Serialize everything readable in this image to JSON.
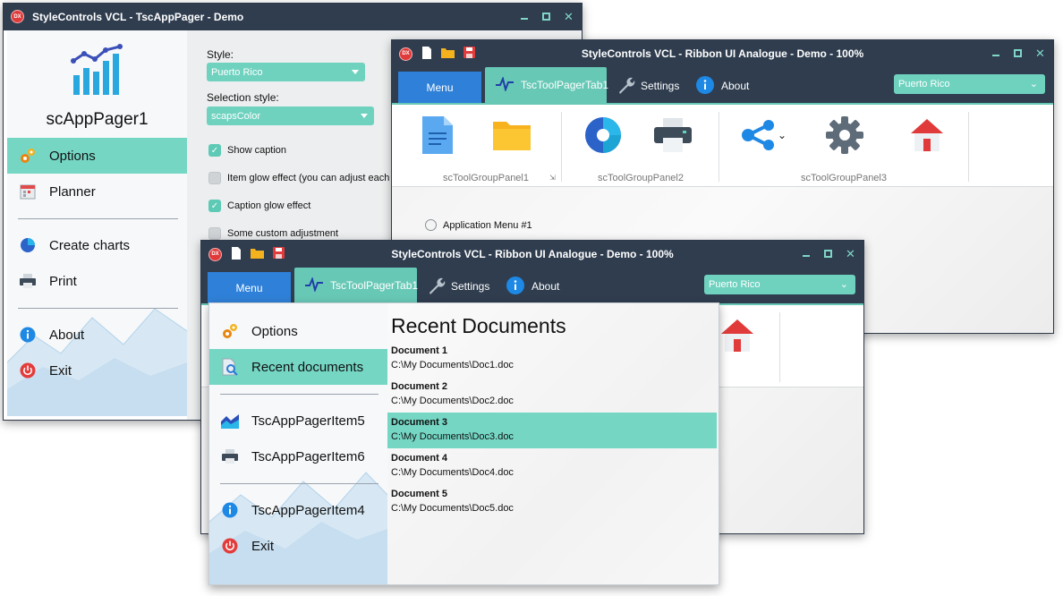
{
  "window1": {
    "title": "StyleControls VCL - TscAppPager - Demo",
    "pager": {
      "caption": "scAppPager1",
      "items": [
        {
          "label": "Options",
          "icon": "gears-icon",
          "selected": true
        },
        {
          "label": "Planner",
          "icon": "calendar-icon"
        },
        {
          "label": "Create charts",
          "icon": "pie-chart-icon"
        },
        {
          "label": "Print",
          "icon": "printer-icon"
        },
        {
          "label": "About",
          "icon": "info-icon"
        },
        {
          "label": "Exit",
          "icon": "power-icon"
        }
      ]
    },
    "options": {
      "style_label": "Style:",
      "style_value": "Puerto Rico",
      "selection_label": "Selection style:",
      "selection_value": "scapsColor",
      "checks": [
        {
          "label": "Show caption",
          "checked": true
        },
        {
          "label": "Item glow effect (you can adjust each",
          "checked": false
        },
        {
          "label": "Caption glow effect",
          "checked": true
        },
        {
          "label": "Some custom adjustment",
          "checked": false
        }
      ]
    }
  },
  "ribbon": {
    "title": "StyleControls VCL - Ribbon UI Analogue - Demo - 100%",
    "tabs": {
      "menu": "Menu",
      "pager_tab": "TscToolPagerTab1",
      "settings": "Settings",
      "about": "About"
    },
    "style_value": "Puerto Rico",
    "groups": [
      "scToolGroupPanel1",
      "scToolGroupPanel2",
      "scToolGroupPanel3"
    ],
    "radio_label": "Application Menu #1"
  },
  "app_menu": {
    "items": [
      {
        "label": "Options",
        "icon": "gears-icon"
      },
      {
        "label": "Recent documents",
        "icon": "document-search-icon",
        "selected": true
      },
      {
        "label": "TscAppPagerItem5",
        "icon": "area-chart-icon"
      },
      {
        "label": "TscAppPagerItem6",
        "icon": "printer-icon"
      },
      {
        "label": "TscAppPagerItem4",
        "icon": "info-icon"
      },
      {
        "label": "Exit",
        "icon": "power-icon"
      }
    ],
    "recent_title": "Recent Documents",
    "documents": [
      {
        "name": "Document 1",
        "path": "C:\\My Documents\\Doc1.doc"
      },
      {
        "name": "Document 2",
        "path": "C:\\My Documents\\Doc2.doc"
      },
      {
        "name": "Document 3",
        "path": "C:\\My Documents\\Doc3.doc",
        "selected": true
      },
      {
        "name": "Document 4",
        "path": "C:\\My Documents\\Doc4.doc"
      },
      {
        "name": "Document 5",
        "path": "C:\\My Documents\\Doc5.doc"
      }
    ]
  },
  "colors": {
    "titlebar": "#2f3d4f",
    "accent": "#75d6c4",
    "menu_tab": "#2f80d8"
  }
}
